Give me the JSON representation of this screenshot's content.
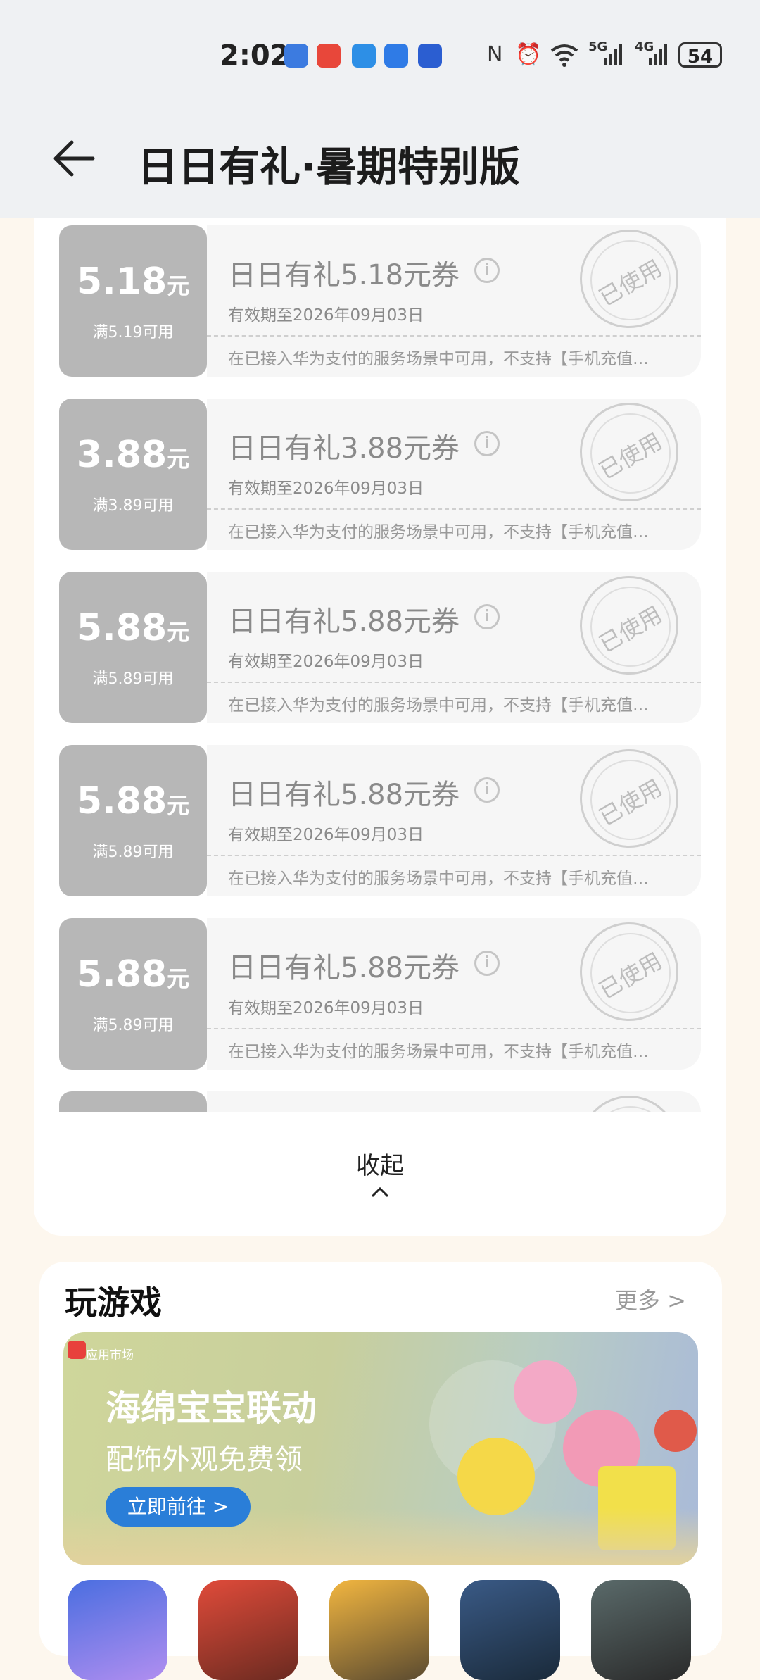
{
  "status": {
    "time": "2:02",
    "network_labels": [
      "5G",
      "4G"
    ],
    "battery": "54"
  },
  "header": {
    "title": "日日有礼·暑期特别版"
  },
  "coupons": [
    {
      "amount": "5.18",
      "unit": "元",
      "condition": "满5.19可用",
      "name": "日日有礼5.18元券",
      "expiry": "有效期至2026年09月03日",
      "desc": "在已接入华为支付的服务场景中可用，不支持【手机充值…",
      "stamp": "已使用"
    },
    {
      "amount": "3.88",
      "unit": "元",
      "condition": "满3.89可用",
      "name": "日日有礼3.88元券",
      "expiry": "有效期至2026年09月03日",
      "desc": "在已接入华为支付的服务场景中可用，不支持【手机充值…",
      "stamp": "已使用"
    },
    {
      "amount": "5.88",
      "unit": "元",
      "condition": "满5.89可用",
      "name": "日日有礼5.88元券",
      "expiry": "有效期至2026年09月03日",
      "desc": "在已接入华为支付的服务场景中可用，不支持【手机充值…",
      "stamp": "已使用"
    },
    {
      "amount": "5.88",
      "unit": "元",
      "condition": "满5.89可用",
      "name": "日日有礼5.88元券",
      "expiry": "有效期至2026年09月03日",
      "desc": "在已接入华为支付的服务场景中可用，不支持【手机充值…",
      "stamp": "已使用"
    },
    {
      "amount": "5.88",
      "unit": "元",
      "condition": "满5.89可用",
      "name": "日日有礼5.88元券",
      "expiry": "有效期至2026年09月03日",
      "desc": "在已接入华为支付的服务场景中可用，不支持【手机充值…",
      "stamp": "已使用"
    }
  ],
  "collapse_label": "收起",
  "games": {
    "title": "玩游戏",
    "more": "更多 >",
    "banner": {
      "store_label": "应用市场",
      "headline": "海绵宝宝联动",
      "subline": "配饰外观免费领",
      "cta": "立即前往 >"
    },
    "app_icons": [
      "egg-party-game-icon",
      "honor-of-kings-game-icon",
      "peacekeeper-elite-game-icon",
      "identity-v-game-icon",
      "delta-force-game-icon"
    ]
  },
  "colors": {
    "coupon_left": "#b7b7b7",
    "cta_blue": "#2a7ed8",
    "page_bg": "#fdf7ee"
  }
}
